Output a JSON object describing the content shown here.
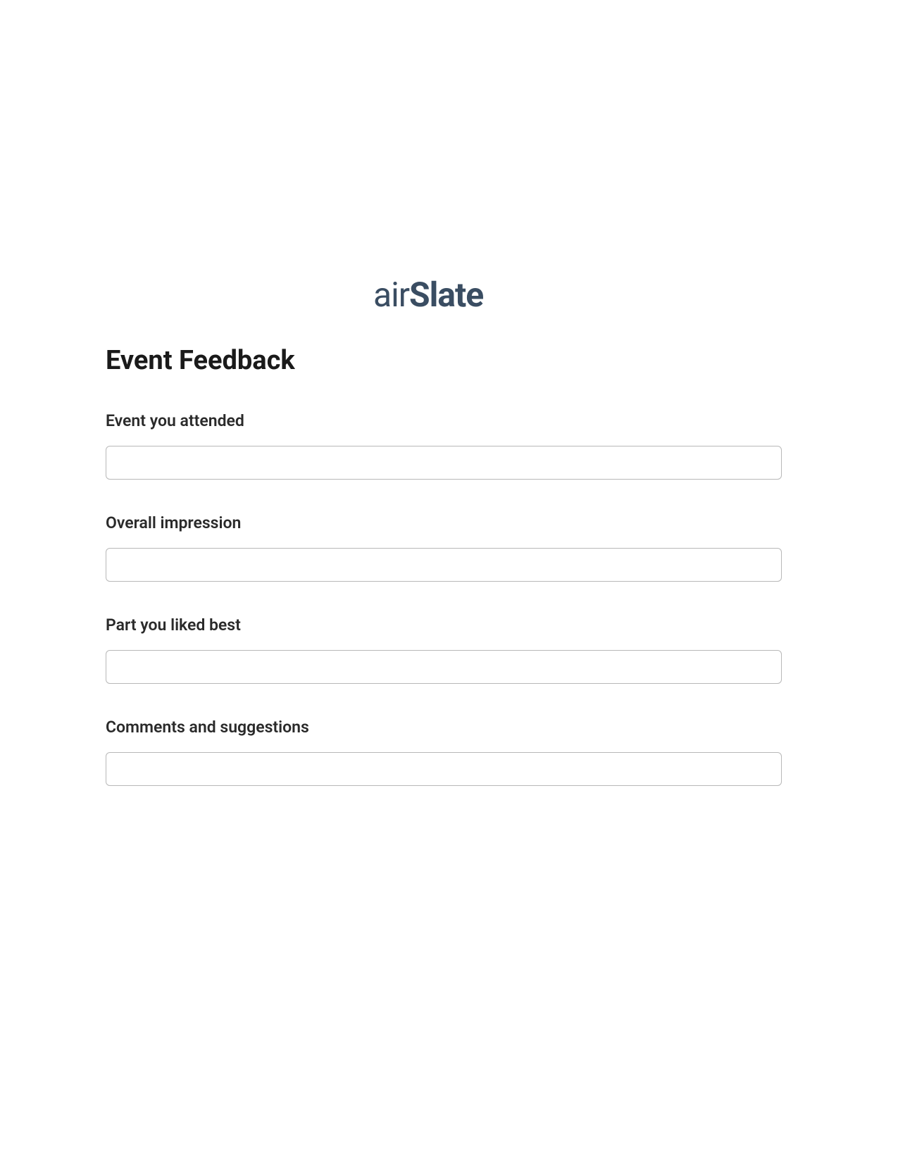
{
  "logo": {
    "part1": "air",
    "part2": "Slate"
  },
  "form": {
    "title": "Event Feedback",
    "fields": [
      {
        "label": "Event you attended",
        "value": ""
      },
      {
        "label": "Overall impression",
        "value": ""
      },
      {
        "label": "Part you liked best",
        "value": ""
      },
      {
        "label": "Comments and suggestions",
        "value": ""
      }
    ]
  }
}
